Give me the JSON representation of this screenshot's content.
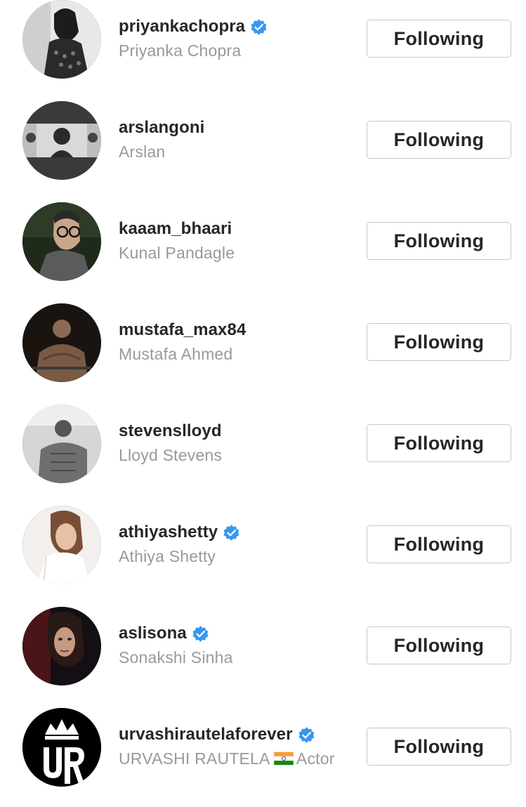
{
  "colors": {
    "username": "#262626",
    "fullname": "#999999",
    "verified": "#3897f0",
    "button_border": "#c7c7c7",
    "button_text": "#262626"
  },
  "follow_list": [
    {
      "username": "priyankachopra",
      "full_name": "Priyanka Chopra",
      "verified": true,
      "button": "Following"
    },
    {
      "username": "arslangoni",
      "full_name": "Arslan",
      "verified": false,
      "button": "Following"
    },
    {
      "username": "kaaam_bhaari",
      "full_name": "Kunal Pandagle",
      "verified": false,
      "button": "Following"
    },
    {
      "username": "mustafa_max84",
      "full_name": "Mustafa Ahmed",
      "verified": false,
      "button": "Following"
    },
    {
      "username": "stevenslloyd",
      "full_name": "Lloyd Stevens",
      "verified": false,
      "button": "Following"
    },
    {
      "username": "athiyashetty",
      "full_name": "Athiya Shetty",
      "verified": true,
      "button": "Following"
    },
    {
      "username": "aslisona",
      "full_name": "Sonakshi Sinha",
      "verified": true,
      "button": "Following"
    },
    {
      "username": "urvashirautelaforever",
      "full_name": "URVASHI RAUTELA",
      "full_name_suffix": "Actor",
      "full_name_icon": "india-flag-emoji",
      "verified": true,
      "button": "Following"
    }
  ]
}
